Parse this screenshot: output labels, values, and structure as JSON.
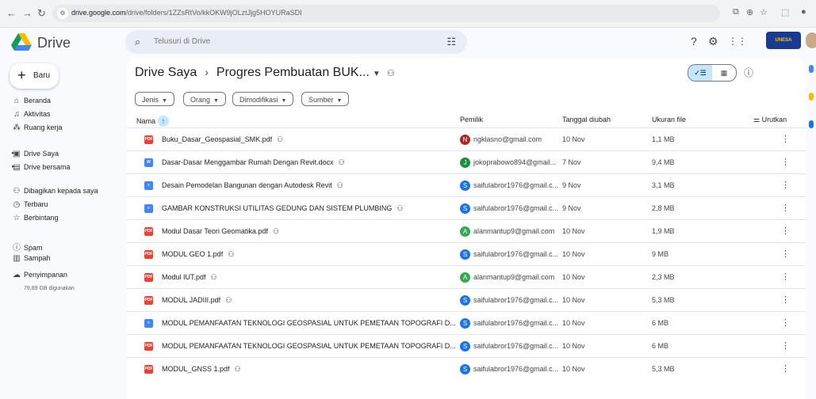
{
  "browser": {
    "url_host": "drive.google.com",
    "url_path": "/drive/folders/1ZZsRtVo/kkOKW9jOLztJjg5HOYURaSDI",
    "back_icon": "arrow-left",
    "forward_icon": "arrow-right",
    "reload_icon": "reload"
  },
  "app": {
    "title": "Drive"
  },
  "search": {
    "placeholder": "Telusuri di Drive"
  },
  "account": {
    "badge": "UNESA"
  },
  "sidebar": {
    "new_label": "Baru",
    "items": [
      {
        "label": "Beranda",
        "icon": "home-icon"
      },
      {
        "label": "Aktivitas",
        "icon": "bell-icon"
      },
      {
        "label": "Ruang kerja",
        "icon": "workspace-icon"
      },
      {
        "label": "Drive Saya",
        "icon": "my-drive-icon"
      },
      {
        "label": "Drive bersama",
        "icon": "shared-drive-icon"
      },
      {
        "label": "Dibagikan kepada saya",
        "icon": "people-icon"
      },
      {
        "label": "Terbaru",
        "icon": "clock-icon"
      },
      {
        "label": "Berbintang",
        "icon": "star-icon"
      },
      {
        "label": "Spam",
        "icon": "spam-icon"
      },
      {
        "label": "Sampah",
        "icon": "trash-icon"
      },
      {
        "label": "Penyimpanan",
        "icon": "cloud-icon"
      }
    ],
    "storage_text": "79,89 GB digunakan"
  },
  "breadcrumb": {
    "root": "Drive Saya",
    "separator": "›",
    "current": "Progres Pembuatan BUK..."
  },
  "filters": [
    "Jenis",
    "Orang",
    "Dimodifikasi",
    "Sumber"
  ],
  "table": {
    "headers": {
      "name": "Nama",
      "owner": "Pemilik",
      "modified": "Tanggal diubah",
      "size": "Ukuran file",
      "sort": "Urutkan"
    },
    "rows": [
      {
        "name": "Buku_Dasar_Geospasial_SMK.pdf",
        "type": "pdf",
        "owner": "ngklasno@gmail.com",
        "initial": "N",
        "avatar_color": "#b3261e",
        "date": "10 Nov",
        "size": "1,1 MB"
      },
      {
        "name": "Dasar-Dasar Menggambar Rumah Dengan Revit.docx",
        "type": "doc",
        "owner": "jokoprabowo894@gmail...",
        "initial": "J",
        "avatar_color": "#1e8e3e",
        "date": "7 Nov",
        "size": "9,4 MB"
      },
      {
        "name": "Desain Pemodelan Bangunan dengan Autodesk Revit",
        "type": "gdoc",
        "owner": "saifulabror1976@gmail.c...",
        "initial": "S",
        "avatar_color": "#1a73e8",
        "date": "9 Nov",
        "size": "3,1 MB"
      },
      {
        "name": "GAMBAR KONSTRUKSI UTILITAS GEDUNG DAN SISTEM PLUMBING",
        "type": "gdoc",
        "owner": "saifulabror1976@gmail.c...",
        "initial": "S",
        "avatar_color": "#1a73e8",
        "date": "9 Nov",
        "size": "2,8 MB"
      },
      {
        "name": "Modul Dasar Teori Geomatika.pdf",
        "type": "pdf",
        "owner": "alanmantup9@gmail.com",
        "initial": "A",
        "avatar_color": "#34a853",
        "date": "10 Nov",
        "size": "1,9 MB"
      },
      {
        "name": "MODUL GEO 1.pdf",
        "type": "pdf",
        "owner": "saifulabror1976@gmail.c...",
        "initial": "S",
        "avatar_color": "#1a73e8",
        "date": "10 Nov",
        "size": "9 MB"
      },
      {
        "name": "Modul IUT.pdf",
        "type": "pdf",
        "owner": "alanmantup9@gmail.com",
        "initial": "A",
        "avatar_color": "#34a853",
        "date": "10 Nov",
        "size": "2,3 MB"
      },
      {
        "name": "MODUL JADIII.pdf",
        "type": "pdf",
        "owner": "saifulabror1976@gmail.c...",
        "initial": "S",
        "avatar_color": "#1a73e8",
        "date": "10 Nov",
        "size": "5,3 MB"
      },
      {
        "name": "MODUL PEMANFAATAN TEKNOLOGI GEOSPASIAL UNTUK PEMETAAN TOPOGRAFI D...",
        "type": "gdoc",
        "owner": "saifulabror1976@gmail.c...",
        "initial": "S",
        "avatar_color": "#1a73e8",
        "date": "10 Nov",
        "size": "6 MB"
      },
      {
        "name": "MODUL PEMANFAATAN TEKNOLOGI GEOSPASIAL UNTUK PEMETAAN TOPOGRAFI D...",
        "type": "pdf",
        "owner": "saifulabror1976@gmail.c...",
        "initial": "S",
        "avatar_color": "#1a73e8",
        "date": "10 Nov",
        "size": "6 MB"
      },
      {
        "name": "MODUL_GNSS 1.pdf",
        "type": "pdf",
        "owner": "saifulabror1976@gmail.c...",
        "initial": "S",
        "avatar_color": "#1a73e8",
        "date": "10 Nov",
        "size": "5,3 MB"
      }
    ]
  },
  "colors": {
    "pdf": "#ea4335",
    "doc": "#4285f4",
    "gdoc": "#4285f4",
    "accent": "#c2e7ff"
  }
}
